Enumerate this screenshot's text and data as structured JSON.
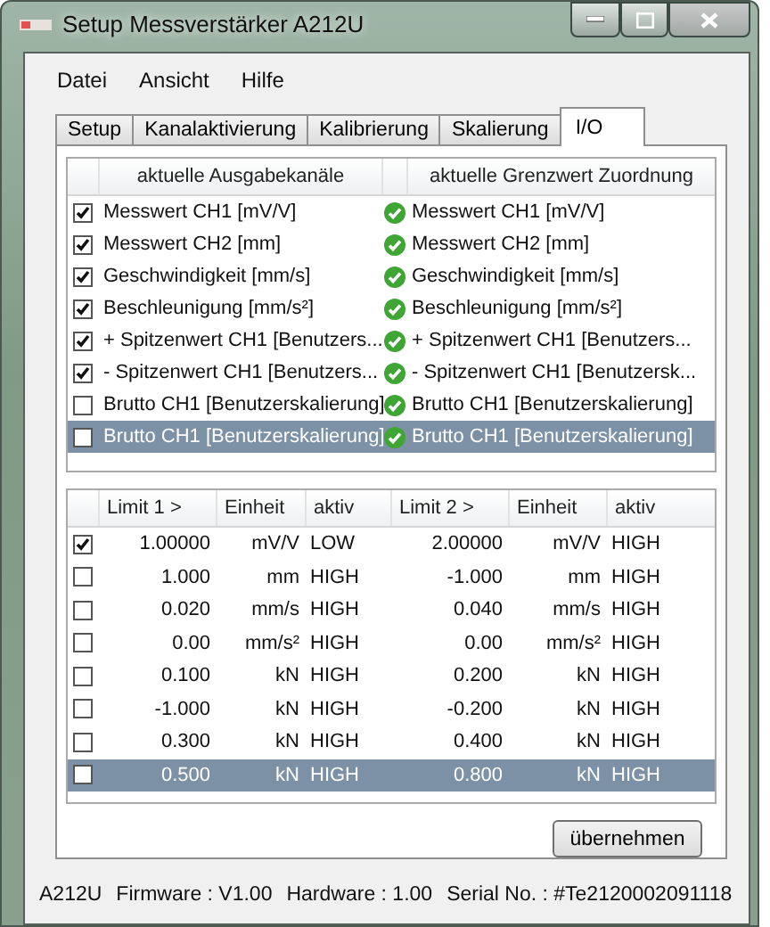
{
  "window": {
    "title": "Setup Messverstärker A212U"
  },
  "menu": [
    "Datei",
    "Ansicht",
    "Hilfe"
  ],
  "tabs": [
    {
      "label": "Setup",
      "selected": false
    },
    {
      "label": "Kanalaktivierung",
      "selected": false
    },
    {
      "label": "Kalibrierung",
      "selected": false
    },
    {
      "label": "Skalierung",
      "selected": false
    },
    {
      "label": "I/O",
      "selected": true
    }
  ],
  "output_channels": {
    "columns": [
      "aktuelle Ausgabekanäle",
      "aktuelle Grenzwert Zuordnung"
    ],
    "rows": [
      {
        "checked": true,
        "selected": false,
        "channel": "Messwert CH1 [mV/V]",
        "assignment": "Messwert CH1 [mV/V]"
      },
      {
        "checked": true,
        "selected": false,
        "channel": "Messwert CH2 [mm]",
        "assignment": "Messwert CH2 [mm]"
      },
      {
        "checked": true,
        "selected": false,
        "channel": "Geschwindigkeit [mm/s]",
        "assignment": "Geschwindigkeit [mm/s]"
      },
      {
        "checked": true,
        "selected": false,
        "channel": "Beschleunigung [mm/s²]",
        "assignment": "Beschleunigung [mm/s²]"
      },
      {
        "checked": true,
        "selected": false,
        "channel": "+ Spitzenwert CH1 [Benutzers...",
        "assignment": "+ Spitzenwert CH1 [Benutzers..."
      },
      {
        "checked": true,
        "selected": false,
        "channel": "- Spitzenwert CH1 [Benutzers...",
        "assignment": "- Spitzenwert CH1 [Benutzersk..."
      },
      {
        "checked": false,
        "selected": false,
        "channel": "Brutto CH1 [Benutzerskalierung]",
        "assignment": "Brutto CH1 [Benutzerskalierung]"
      },
      {
        "checked": false,
        "selected": true,
        "channel": "Brutto CH1 [Benutzerskalierung]",
        "assignment": "Brutto CH1 [Benutzerskalierung]"
      }
    ]
  },
  "limits": {
    "columns": [
      "Limit 1 >",
      "Einheit",
      "aktiv",
      "Limit 2 >",
      "Einheit",
      "aktiv"
    ],
    "rows": [
      {
        "checked": true,
        "selected": false,
        "cells": [
          "1.00000",
          "mV/V",
          "LOW",
          "2.00000",
          "mV/V",
          "HIGH"
        ]
      },
      {
        "checked": false,
        "selected": false,
        "cells": [
          "1.000",
          "mm",
          "HIGH",
          "-1.000",
          "mm",
          "HIGH"
        ]
      },
      {
        "checked": false,
        "selected": false,
        "cells": [
          "0.020",
          "mm/s",
          "HIGH",
          "0.040",
          "mm/s",
          "HIGH"
        ]
      },
      {
        "checked": false,
        "selected": false,
        "cells": [
          "0.00",
          "mm/s²",
          "HIGH",
          "0.00",
          "mm/s²",
          "HIGH"
        ]
      },
      {
        "checked": false,
        "selected": false,
        "cells": [
          "0.100",
          "kN",
          "HIGH",
          "0.200",
          "kN",
          "HIGH"
        ]
      },
      {
        "checked": false,
        "selected": false,
        "cells": [
          "-1.000",
          "kN",
          "HIGH",
          "-0.200",
          "kN",
          "HIGH"
        ]
      },
      {
        "checked": false,
        "selected": false,
        "cells": [
          "0.300",
          "kN",
          "HIGH",
          "0.400",
          "kN",
          "HIGH"
        ]
      },
      {
        "checked": false,
        "selected": true,
        "cells": [
          "0.500",
          "kN",
          "HIGH",
          "0.800",
          "kN",
          "HIGH"
        ]
      }
    ]
  },
  "apply_button": "übernehmen",
  "status_bar": [
    "A212U",
    "Firmware : V1.00",
    "Hardware : 1.00",
    "Serial No. : #Te2120002091118"
  ]
}
